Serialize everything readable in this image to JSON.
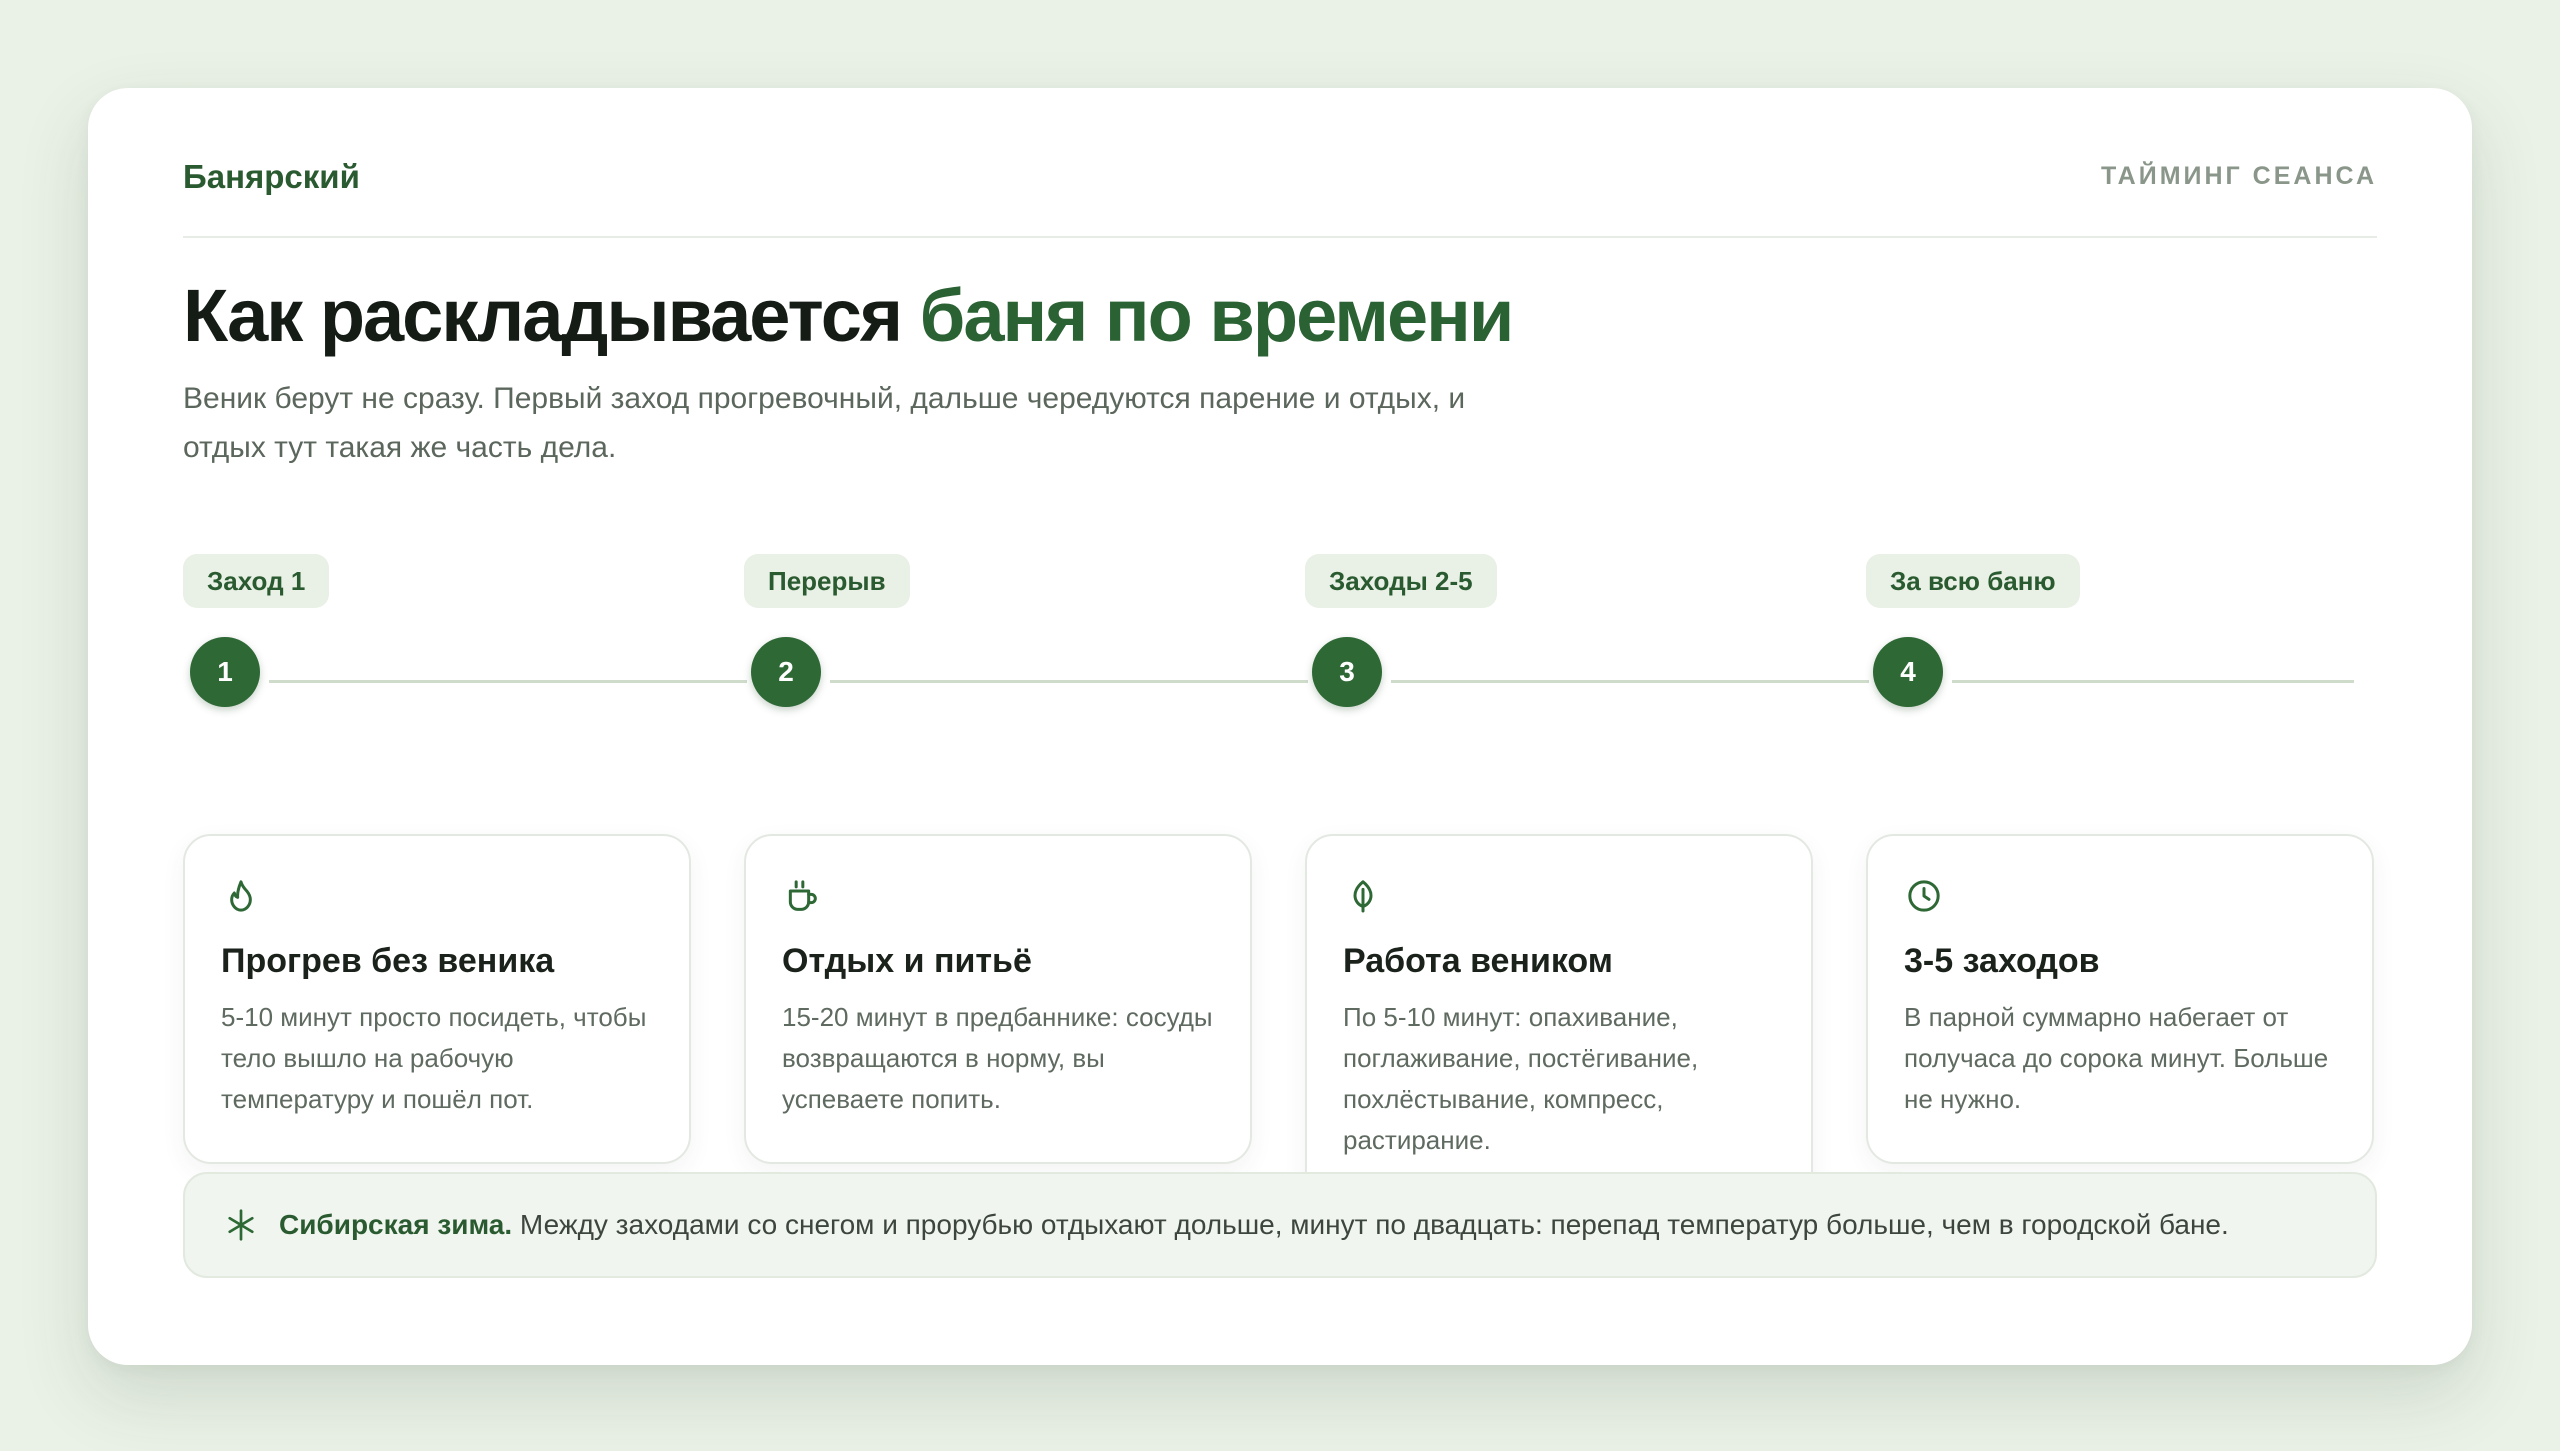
{
  "brand": "Банярский",
  "eyebrow": "ТАЙМИНГ СЕАНСА",
  "headline": {
    "main": "Как раскладывается ",
    "accent": "баня по времени"
  },
  "lead": "Веник берут не сразу. Первый заход прогревочный, дальше чередуются парение и отдых, и отдых тут такая же часть дела.",
  "steps": [
    {
      "tag": "Заход 1",
      "number": "1",
      "icon": "flame-icon",
      "title": "Прогрев без веника",
      "text": "5-10 минут просто посидеть, чтобы тело вышло на рабочую температуру и пошёл пот."
    },
    {
      "tag": "Перерыв",
      "number": "2",
      "icon": "cup-icon",
      "title": "Отдых и питьё",
      "text": "15-20 минут в предбаннике: сосуды возвращаются в норму, вы успеваете попить."
    },
    {
      "tag": "Заходы 2-5",
      "number": "3",
      "icon": "leaf-icon",
      "title": "Работа веником",
      "text": "По 5-10 минут: опахивание, поглаживание, постёгивание, похлёстывание, компресс, растирание."
    },
    {
      "tag": "За всю баню",
      "number": "4",
      "icon": "clock-icon",
      "title": "3-5 заходов",
      "text": "В парной суммарно набегает от получаса до сорока минут. Больше не нужно."
    }
  ],
  "note": {
    "icon": "snowflake-icon",
    "bold": "Сибирская зима.",
    "text": " Между заходами со снегом и прорубью отдыхают дольше, минут по двадцать: перепад температур больше, чем в городской бане."
  },
  "colors": {
    "accent": "#2d6835",
    "background": "#eaf1e7",
    "pill": "#e9f0e5"
  }
}
